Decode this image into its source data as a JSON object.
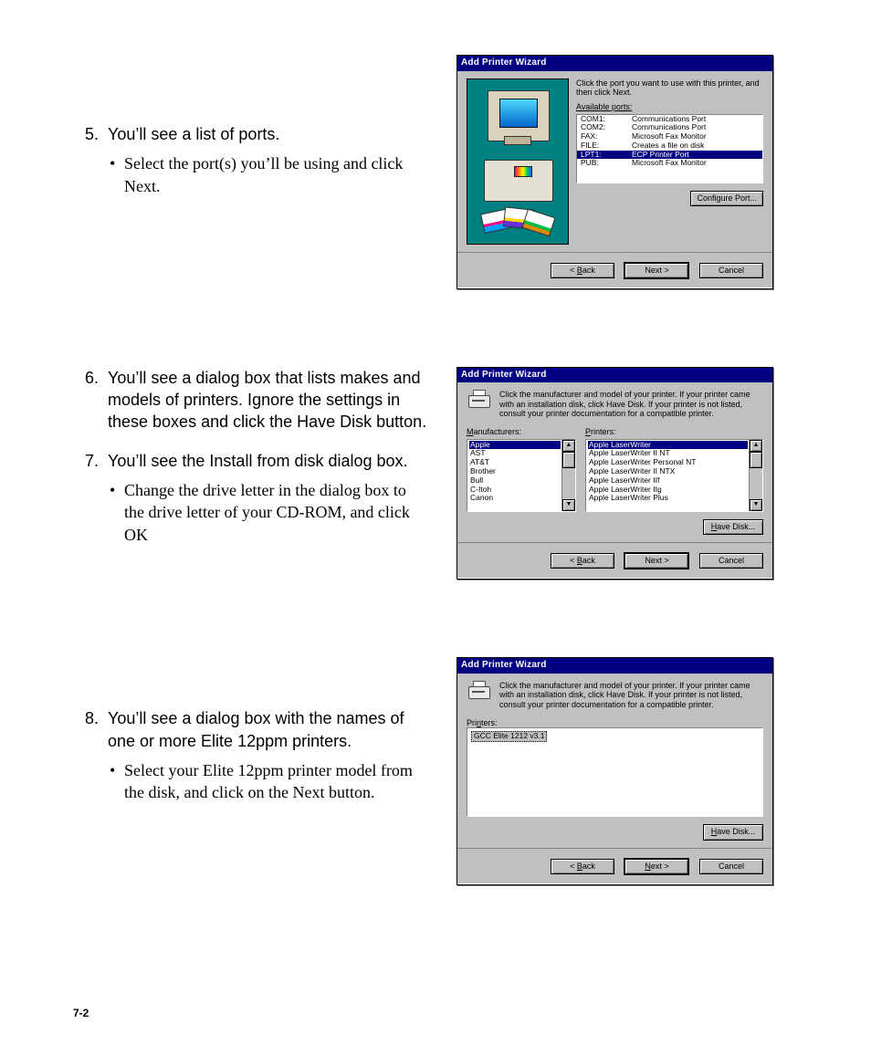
{
  "page_number": "7-2",
  "steps": {
    "s5": {
      "num": "5.",
      "text": "You’ll see a list of ports.",
      "sub": [
        "Select the port(s) you’ll be using and click Next."
      ]
    },
    "s6": {
      "num": "6.",
      "text": "You’ll see a dialog box that lists makes and models of printers. Ignore the settings in these boxes and click the Have Disk button."
    },
    "s7": {
      "num": "7.",
      "text": "You’ll see the Install from disk dialog box.",
      "sub": [
        "Change the drive letter in the dialog box to the drive letter of your CD-ROM, and click OK"
      ]
    },
    "s8": {
      "num": "8.",
      "text": "You’ll see a dialog box with the names of one or more Elite 12ppm printers.",
      "sub": [
        "Select your Elite 12ppm printer model from the disk, and click on the Next button."
      ]
    }
  },
  "dialog1": {
    "title": "Add Printer Wizard",
    "prompt": "Click the port you want to use with this printer, and then click Next.",
    "available_label": "Available ports:",
    "ports": [
      {
        "port": "COM1:",
        "desc": "Communications Port",
        "sel": false
      },
      {
        "port": "COM2:",
        "desc": "Communications Port",
        "sel": false
      },
      {
        "port": "FAX:",
        "desc": "Microsoft Fax Monitor",
        "sel": false
      },
      {
        "port": "FILE:",
        "desc": "Creates a file on disk",
        "sel": false
      },
      {
        "port": "LPT1:",
        "desc": "ECP Printer Port",
        "sel": true
      },
      {
        "port": "PUB:",
        "desc": "Microsoft Fax Monitor",
        "sel": false
      }
    ],
    "configure": "Configure Port...",
    "back": "< Back",
    "next": "Next >",
    "cancel": "Cancel"
  },
  "dialog2": {
    "title": "Add Printer Wizard",
    "prompt": "Click the manufacturer and model of your printer. If your printer came with an installation disk, click Have Disk. If your printer is not listed, consult your printer documentation for a compatible printer.",
    "manuf_label": "Manufacturers:",
    "printers_label": "Printers:",
    "manufacturers": [
      "Apple",
      "AST",
      "AT&T",
      "Brother",
      "Bull",
      "C-Itoh",
      "Canon"
    ],
    "printers": [
      "Apple LaserWriter",
      "Apple LaserWriter II NT",
      "Apple LaserWriter Personal NT",
      "Apple LaserWriter II NTX",
      "Apple LaserWriter IIf",
      "Apple LaserWriter IIg",
      "Apple LaserWriter Plus"
    ],
    "have_disk": "Have Disk...",
    "back": "< Back",
    "next": "Next >",
    "cancel": "Cancel"
  },
  "dialog3": {
    "title": "Add Printer Wizard",
    "prompt": "Click the manufacturer and model of your printer. If your printer came with an installation disk, click Have Disk. If your printer is not listed, consult your printer documentation for a compatible printer.",
    "printers_label": "Printers:",
    "selected_printer": "GCC Elite 1212 v3.1",
    "have_disk": "Have Disk...",
    "back": "< Back",
    "next": "Next >",
    "cancel": "Cancel"
  }
}
